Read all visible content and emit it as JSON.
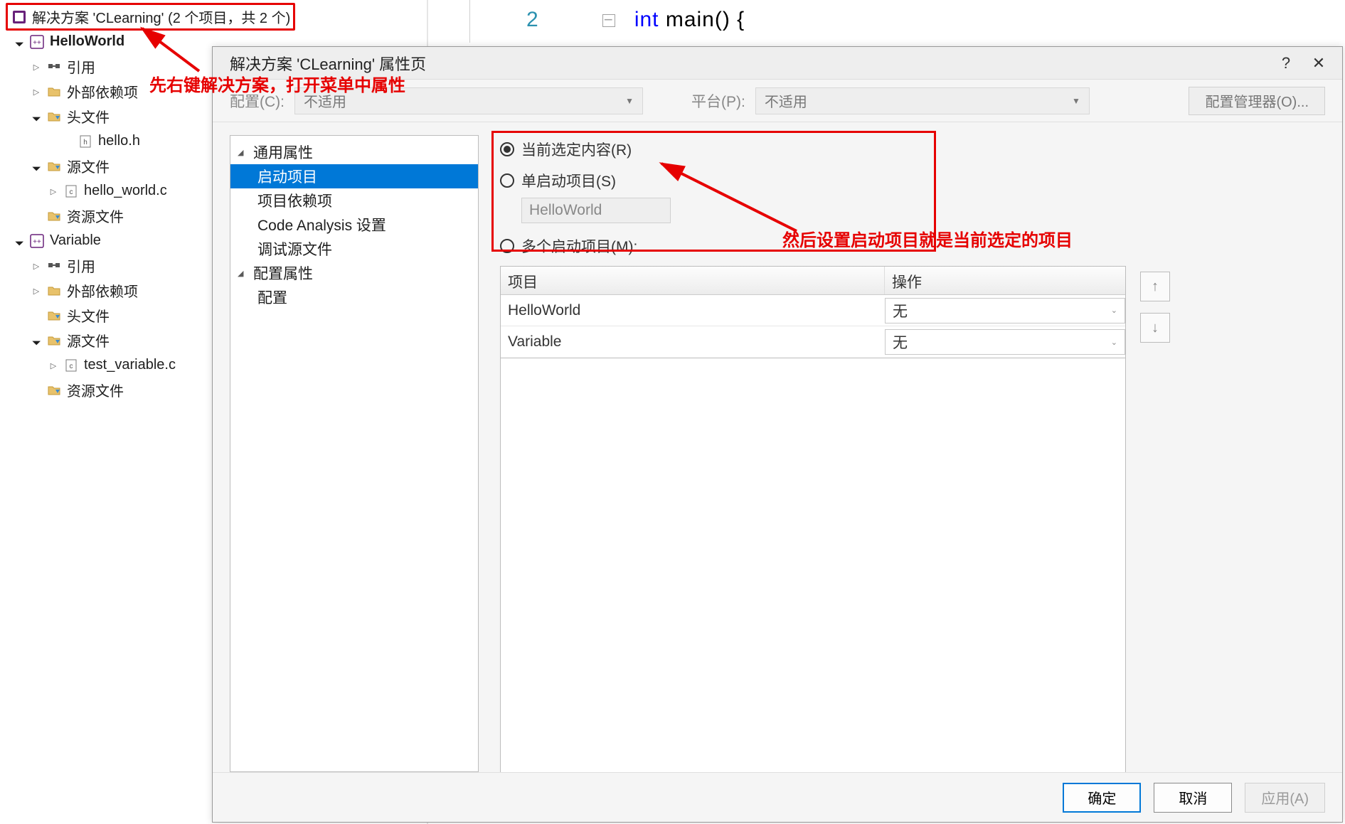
{
  "code_peek": {
    "line_number": "2",
    "keyword": "int",
    "rest": " main() {"
  },
  "annotations": {
    "left_text": "先右键解决方案，打开菜单中属性",
    "right_text": "然后设置启动项目就是当前选定的项目"
  },
  "explorer": {
    "solution_label": "解决方案 'CLearning' (2 个项目，共 2 个)",
    "projects": [
      {
        "name": "HelloWorld",
        "bold": true,
        "children": [
          {
            "label": "引用",
            "icon": "reference-icon",
            "exp": "closed"
          },
          {
            "label": "外部依赖项",
            "icon": "folder-icon",
            "exp": "closed"
          },
          {
            "label": "头文件",
            "icon": "folder-filter-icon",
            "exp": "open",
            "children": [
              {
                "label": "hello.h",
                "icon": "h-file-icon"
              }
            ]
          },
          {
            "label": "源文件",
            "icon": "folder-filter-icon",
            "exp": "open",
            "children": [
              {
                "label": "hello_world.c",
                "icon": "c-file-icon",
                "exp": "closed"
              }
            ]
          },
          {
            "label": "资源文件",
            "icon": "folder-filter-icon",
            "exp": "none"
          }
        ]
      },
      {
        "name": "Variable",
        "bold": false,
        "children": [
          {
            "label": "引用",
            "icon": "reference-icon",
            "exp": "closed"
          },
          {
            "label": "外部依赖项",
            "icon": "folder-icon",
            "exp": "closed"
          },
          {
            "label": "头文件",
            "icon": "folder-filter-icon",
            "exp": "none"
          },
          {
            "label": "源文件",
            "icon": "folder-filter-icon",
            "exp": "open",
            "children": [
              {
                "label": "test_variable.c",
                "icon": "c-file-icon",
                "exp": "closed"
              }
            ]
          },
          {
            "label": "资源文件",
            "icon": "folder-filter-icon",
            "exp": "none"
          }
        ]
      }
    ]
  },
  "dialog": {
    "title": "解决方案 'CLearning' 属性页",
    "help_tooltip": "?",
    "config_label": "配置(C):",
    "config_value": "不适用",
    "platform_label": "平台(P):",
    "platform_value": "不适用",
    "config_manager_btn": "配置管理器(O)...",
    "nav": {
      "group1": "通用属性",
      "items1": [
        "启动项目",
        "项目依赖项",
        "Code Analysis 设置",
        "调试源文件"
      ],
      "group2": "配置属性",
      "items2": [
        "配置"
      ]
    },
    "radios": {
      "current": "当前选定内容(R)",
      "single": "单启动项目(S)",
      "single_value": "HelloWorld",
      "multi": "多个启动项目(M):"
    },
    "grid": {
      "col_project": "项目",
      "col_action": "操作",
      "rows": [
        {
          "project": "HelloWorld",
          "action": "无"
        },
        {
          "project": "Variable",
          "action": "无"
        }
      ]
    },
    "buttons": {
      "ok": "确定",
      "cancel": "取消",
      "apply": "应用(A)"
    }
  }
}
